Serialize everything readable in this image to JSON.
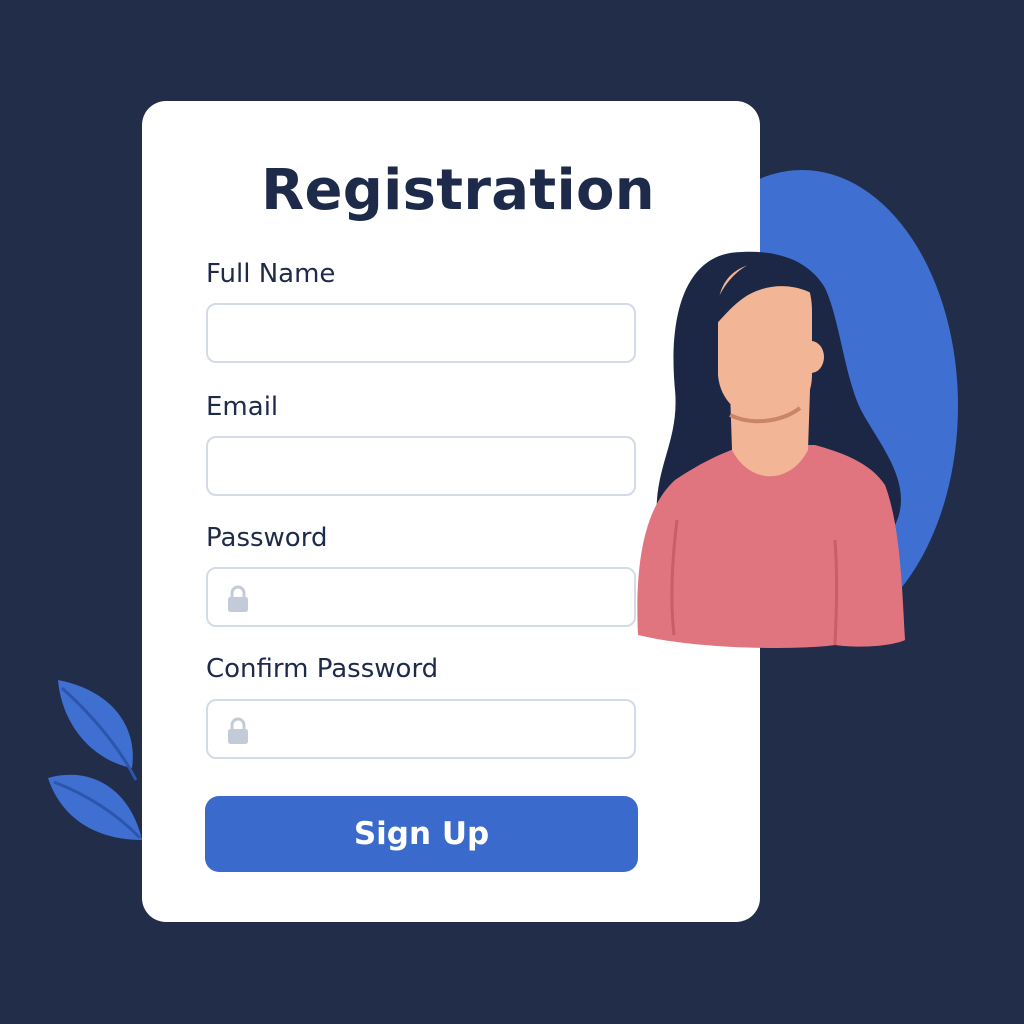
{
  "form": {
    "title": "Registration",
    "fields": [
      {
        "label": "Full Name",
        "value": "",
        "placeholder": "",
        "icon": null
      },
      {
        "label": "Email",
        "value": "",
        "placeholder": "",
        "icon": null
      },
      {
        "label": "Password",
        "value": "",
        "placeholder": "",
        "icon": "lock-icon"
      },
      {
        "label": "Confirm Password",
        "value": "",
        "placeholder": "",
        "icon": "lock-icon"
      }
    ],
    "submit_label": "Sign Up"
  },
  "colors": {
    "background": "#222d4a",
    "card": "#ffffff",
    "accent": "#3a6acb",
    "title_text": "#1e2a4a",
    "field_border": "#d3dae8",
    "person_shirt": "#e07580",
    "person_skin": "#f2b596",
    "person_hair": "#1b2745"
  },
  "illustration": {
    "person": "woman-avatar-illustration",
    "decoration": [
      "blue-circle",
      "leaf-decoration"
    ]
  }
}
